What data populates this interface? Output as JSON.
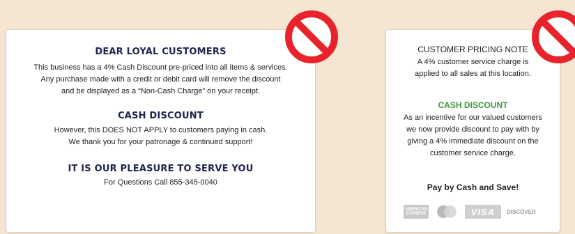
{
  "card_left": {
    "heading1": "DEAR LOYAL CUSTOMERS",
    "para1_line1": "This business has a 4% Cash Discount pre-priced into all items & services.",
    "para1_line2": "Any purchase made with a credit or debit card will remove the discount",
    "para1_line3": "and be displayed as a “Non-Cash Charge” on your receipt.",
    "heading2": "CASH DISCOUNT",
    "para2_line1": "However, this DOES NOT APPLY to customers paying in cash.",
    "para2_line2": "We thank you for your patronage & continued support!",
    "heading3": "IT IS OUR PLEASURE TO SERVE YOU",
    "para3": "For Questions Call 855-345-0040"
  },
  "card_right": {
    "heading1": "CUSTOMER PRICING NOTE",
    "para1_line1": "A 4% customer service charge is",
    "para1_line2": "applied to all sales at this location.",
    "heading2": "CASH DISCOUNT",
    "para2_line1": "As an incentive for our valued customers",
    "para2_line2": "we now provide discount to pay with by",
    "para2_line3": "giving a 4% immediate discount on the",
    "para2_line4": "customer service charge.",
    "heading3": "Pay by Cash and Save!",
    "payment_logos": [
      {
        "icon": "amex-logo-icon",
        "text_line1": "AMERICAN",
        "text_line2": "EXPRESS"
      },
      {
        "icon": "mastercard-logo-icon"
      },
      {
        "icon": "visa-logo-icon",
        "text": "VISA"
      },
      {
        "icon": "discover-logo-icon",
        "text": "DISCÖVER"
      }
    ]
  },
  "colors": {
    "background": "#f4e6d2",
    "heading_navy": "#1f2350",
    "heading_green": "#3d9b3c",
    "no_sign_red": "#e8232b"
  },
  "icons": [
    "prohibition-sign-icon",
    "prohibition-sign-icon"
  ]
}
